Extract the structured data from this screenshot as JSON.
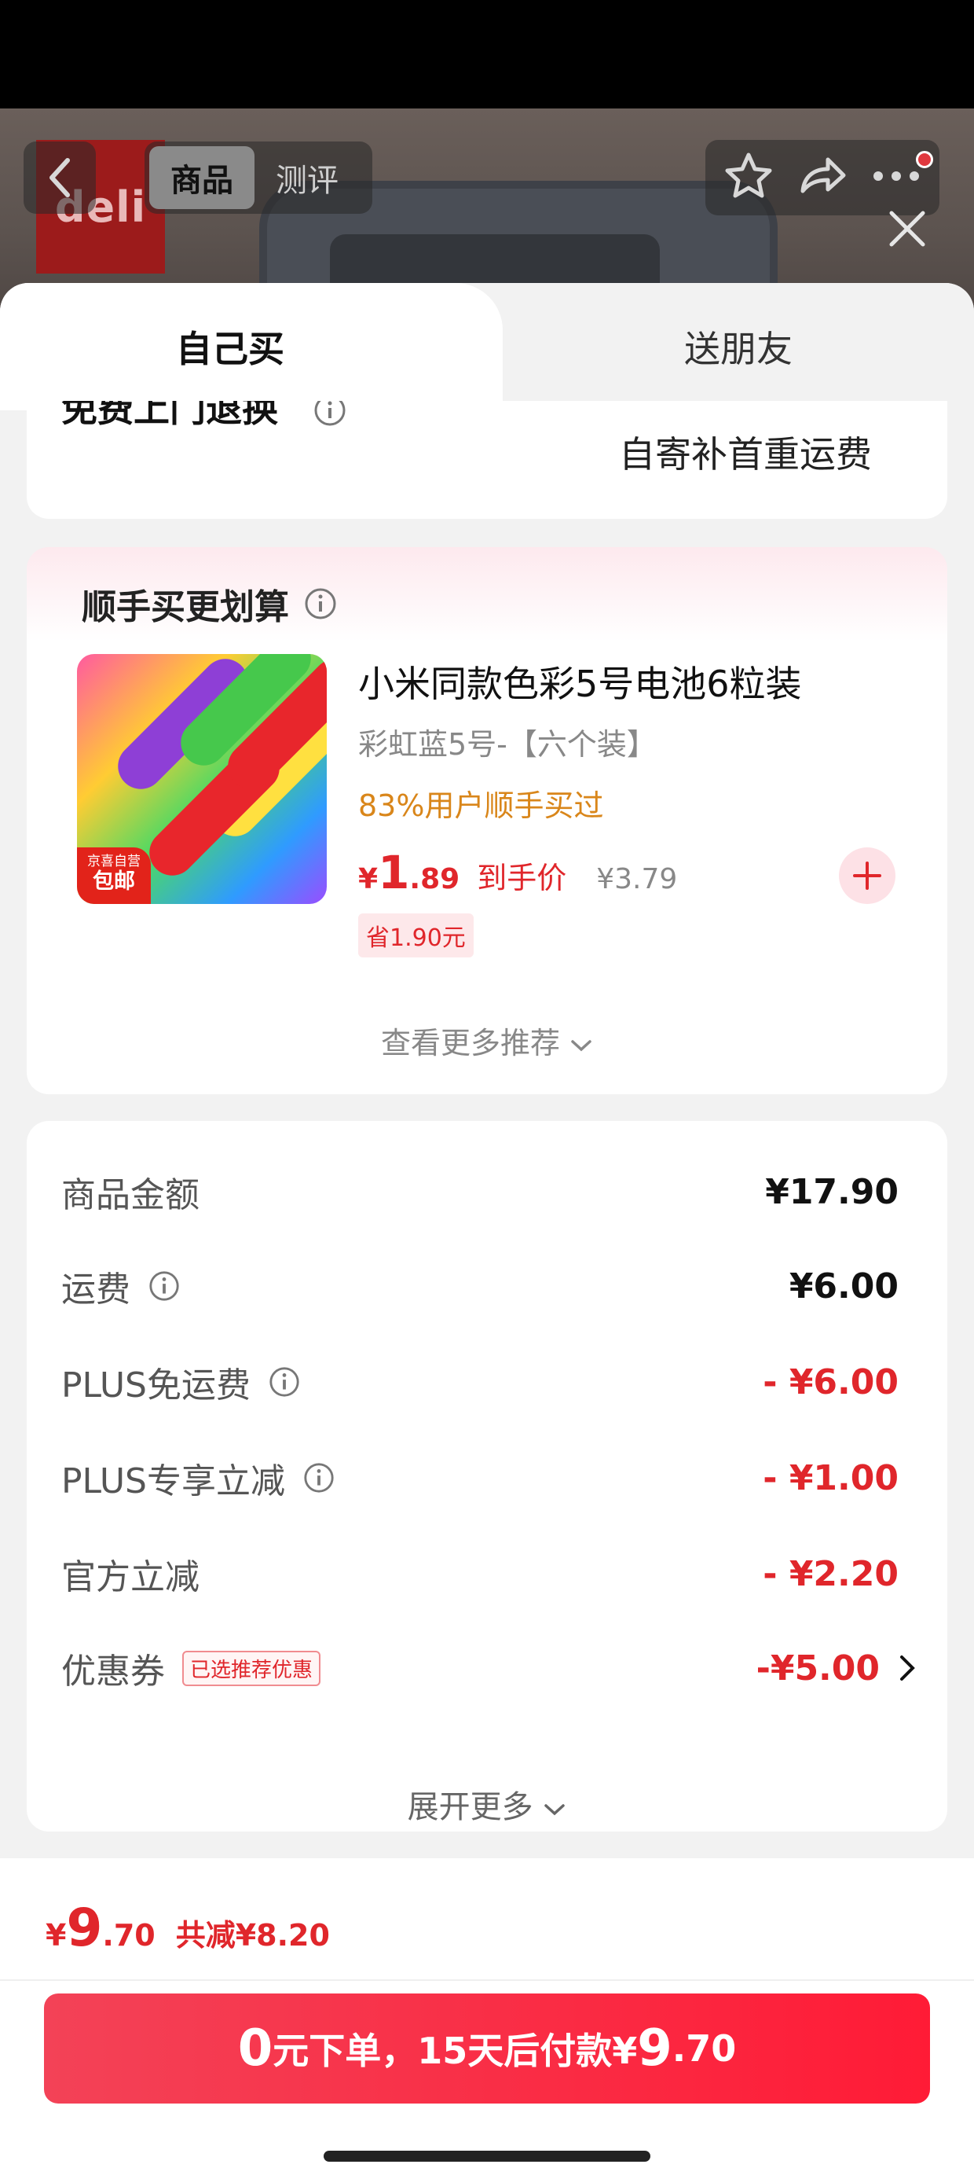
{
  "header": {
    "tabs": [
      "商品",
      "测评"
    ],
    "active_tab": 0,
    "icons": [
      "back-icon",
      "star-icon",
      "share-icon",
      "more-icon",
      "close-icon"
    ]
  },
  "sheet_tabs": {
    "self": "自己买",
    "friend": "送朋友"
  },
  "return_card": {
    "label": "免费上门退换",
    "value": "自寄补首重运费"
  },
  "recommend": {
    "title": "顺手买更划算",
    "product": {
      "name": "小米同款色彩5号电池6粒装",
      "spec": "彩虹蓝5号-【六个装】",
      "stat": "83%用户顺手买过",
      "price_symbol": "¥",
      "price_int": "1",
      "price_dec": ".89",
      "price_label": "到手价",
      "price_old": "¥3.79",
      "save": "省1.90元",
      "badge_top": "京喜自营",
      "badge_bottom": "包邮"
    },
    "more": "查看更多推荐"
  },
  "price_detail": {
    "rows": [
      {
        "label": "商品金额",
        "value": "¥17.90"
      },
      {
        "label": "运费",
        "value": "¥6.00"
      },
      {
        "label": "PLUS免运费",
        "value": "- ¥6.00"
      },
      {
        "label": "PLUS专享立减",
        "value": "- ¥1.00"
      },
      {
        "label": "官方立减",
        "value": "- ¥2.20"
      },
      {
        "label": "优惠券",
        "tag": "已选推荐优惠",
        "value": "-¥5.00"
      }
    ],
    "expand": "展开更多"
  },
  "footer": {
    "price_symbol": "¥",
    "price_int": "9",
    "price_dec": ".70",
    "total_cut": "共减¥8.20",
    "btn_big": "0",
    "btn_text": "元下单，15天后付款¥",
    "btn_price_big": "9",
    "btn_price_dec": ".70"
  },
  "colors": {
    "accent": "#e0262b",
    "stat": "#d9861a"
  }
}
